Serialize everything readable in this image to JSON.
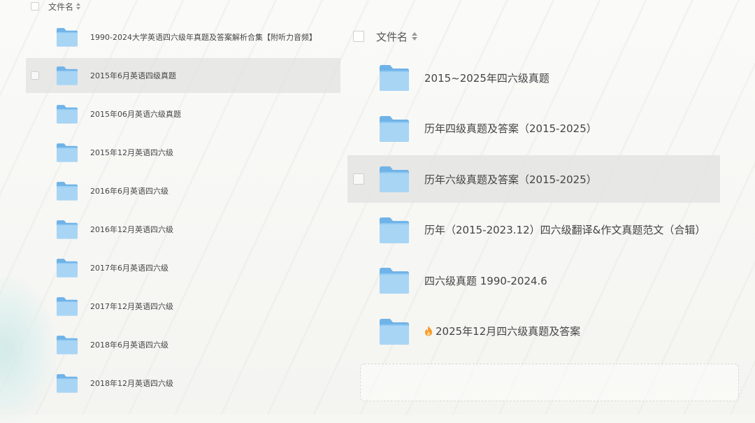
{
  "left": {
    "header_label": "文件名",
    "rows": [
      {
        "name": "1990-2024大学英语四六级年真题及答案解析合集【附听力音频】"
      },
      {
        "name": "2015年6月英语四级真题",
        "highlighted": true
      },
      {
        "name": "2015年06月英语六级真题"
      },
      {
        "name": "2015年12月英语四六级"
      },
      {
        "name": "2016年6月英语四六级"
      },
      {
        "name": "2016年12月英语四六级"
      },
      {
        "name": "2017年6月英语四六级"
      },
      {
        "name": "2017年12月英语四六级"
      },
      {
        "name": "2018年6月英语四六级"
      },
      {
        "name": "2018年12月英语四六级"
      }
    ]
  },
  "right": {
    "header_label": "文件名",
    "rows": [
      {
        "name": "2015~2025年四六级真题"
      },
      {
        "name": "历年四级真题及答案（2015-2025）"
      },
      {
        "name": "历年六级真题及答案（2015-2025）",
        "highlighted": true
      },
      {
        "name": "历年（2015-2023.12）四六级翻译&作文真题范文（合辑）"
      },
      {
        "name": "四六级真题 1990-2024.6"
      },
      {
        "name": "2025年12月四六级真题及答案",
        "icon": "fire-icon"
      }
    ]
  },
  "icons": {
    "folder": "folder-icon",
    "sort": "sort-icon",
    "fire": "fire-icon"
  },
  "colors": {
    "folder_light": "#bfe0f8",
    "folder_main": "#8ec8f2",
    "folder_dark": "#6fb3e8",
    "row_highlight": "#e2e2e0",
    "fire": "#f59a2a"
  }
}
